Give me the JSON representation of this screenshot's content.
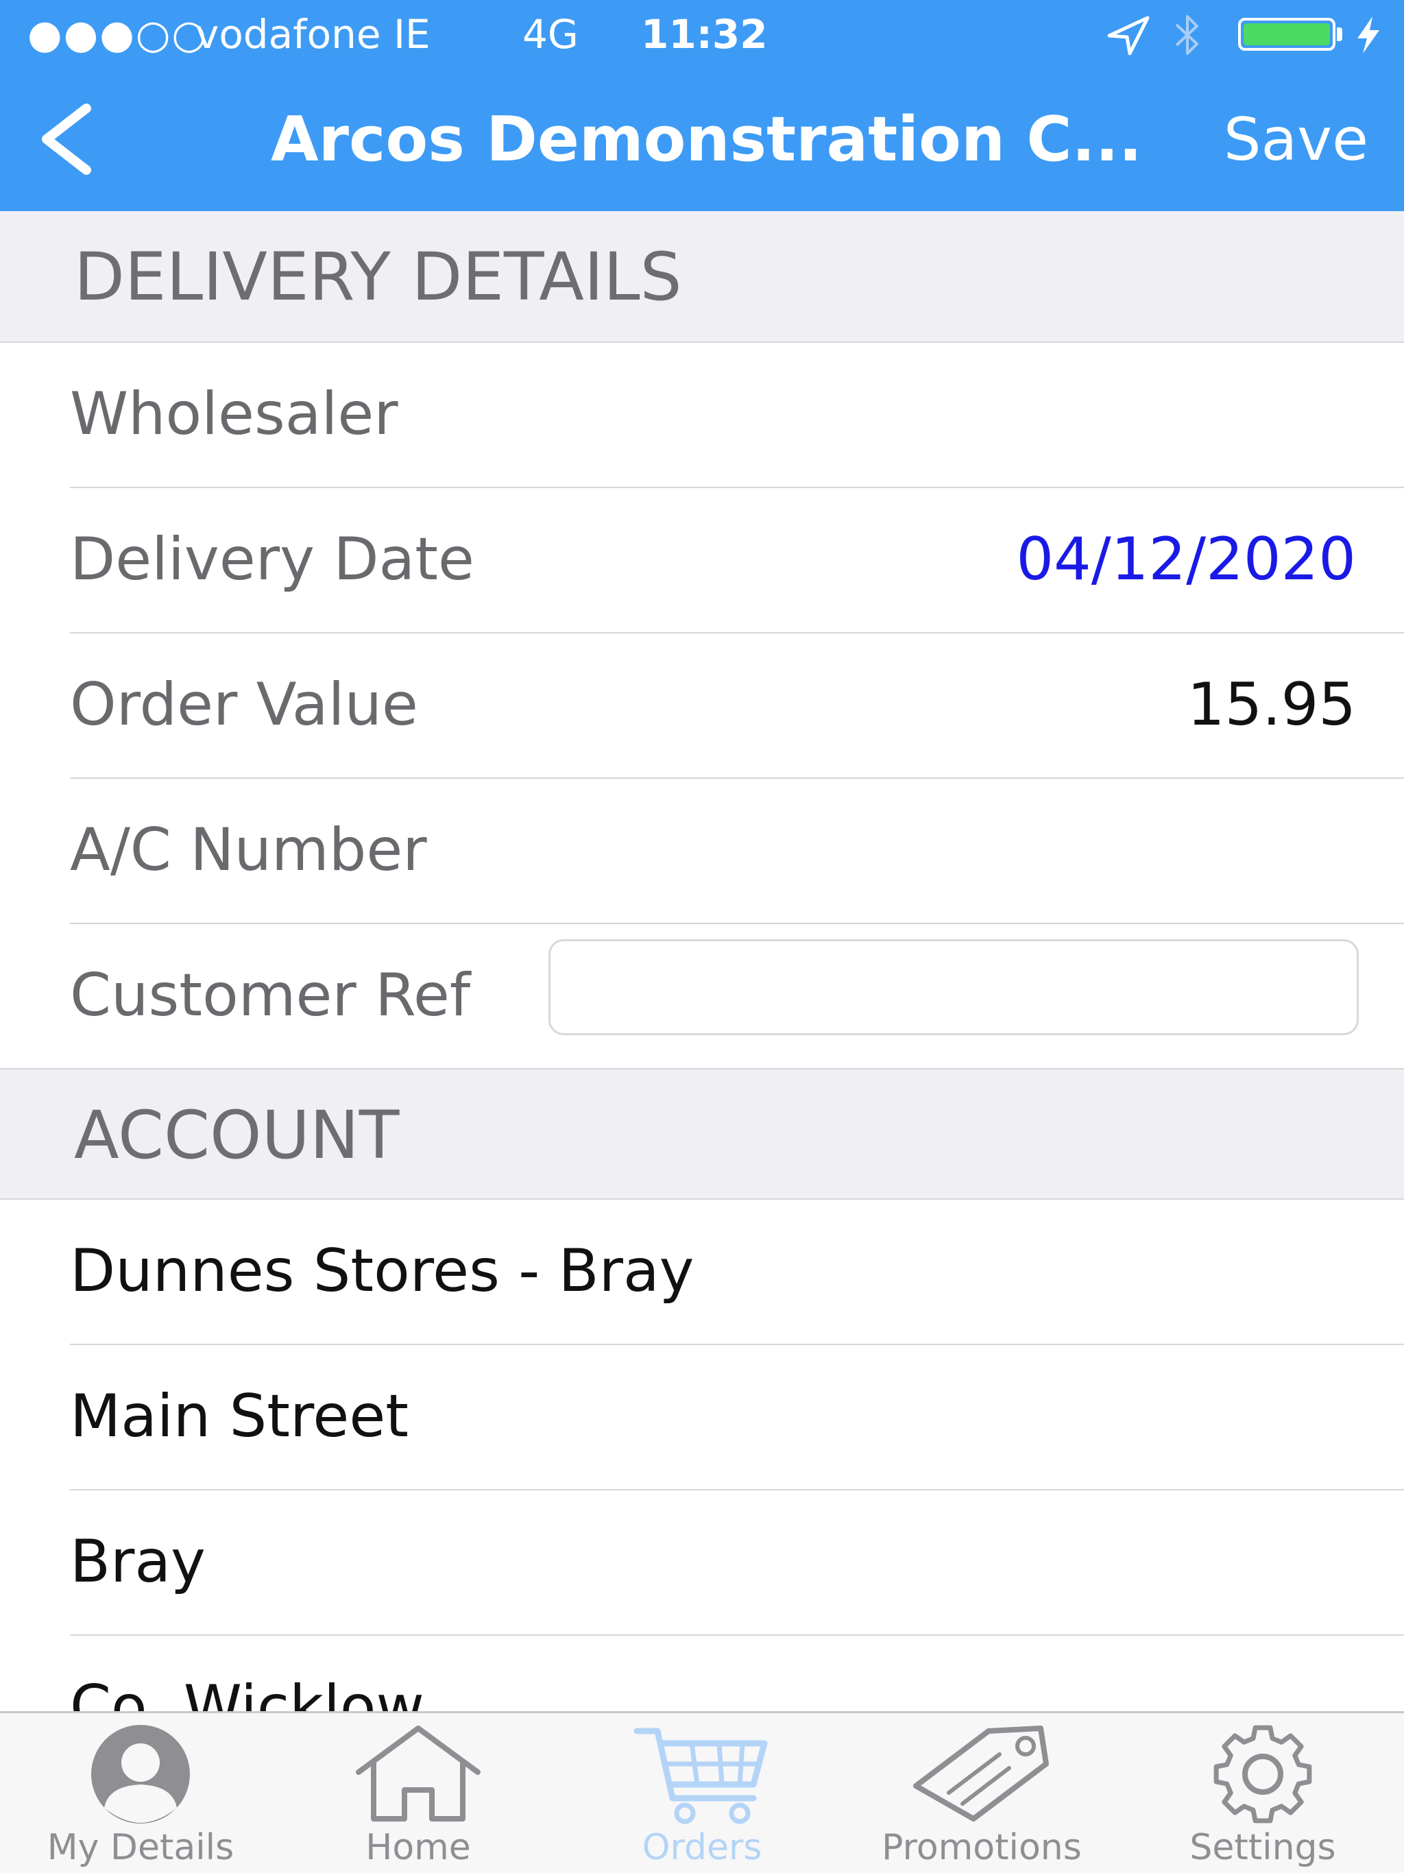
{
  "status_bar": {
    "signal": "●●●○○",
    "carrier": "vodafone IE",
    "network": "4G",
    "time": "11:32",
    "location_icon": "location-arrow-icon",
    "bluetooth_icon": "bluetooth-icon",
    "battery_icon": "battery-icon",
    "battery_level_fraction": 1.0,
    "charging_icon": "lightning-bolt-icon"
  },
  "nav_bar": {
    "back_icon": "chevron-left-icon",
    "title": "Arcos Demonstration C...",
    "save_label": "Save"
  },
  "colors": {
    "nav_background": "#3d9bf5",
    "battery_fill": "#4cd964",
    "date_value": "#1a1ae6",
    "section_background": "#efeff4",
    "active_tab": "#b3d4f7"
  },
  "delivery_section": {
    "header": "DELIVERY DETAILS",
    "wholesaler_label": "Wholesaler",
    "delivery_date_label": "Delivery Date",
    "delivery_date_value": "04/12/2020",
    "order_value_label": "Order Value",
    "order_value": "15.95",
    "ac_number_label": "A/C Number",
    "customer_ref_label": "Customer Ref",
    "customer_ref_value": ""
  },
  "account_section": {
    "header": "ACCOUNT",
    "lines": [
      "Dunnes Stores - Bray",
      "Main Street",
      "Bray",
      "Co. Wicklow"
    ]
  },
  "tab_bar": {
    "tabs": [
      {
        "label": "My Details",
        "icon": "user-avatar-icon"
      },
      {
        "label": "Home",
        "icon": "home-icon"
      },
      {
        "label": "Orders",
        "icon": "shopping-cart-icon",
        "active": true
      },
      {
        "label": "Promotions",
        "icon": "price-tag-icon"
      },
      {
        "label": "Settings",
        "icon": "gear-icon"
      }
    ]
  }
}
